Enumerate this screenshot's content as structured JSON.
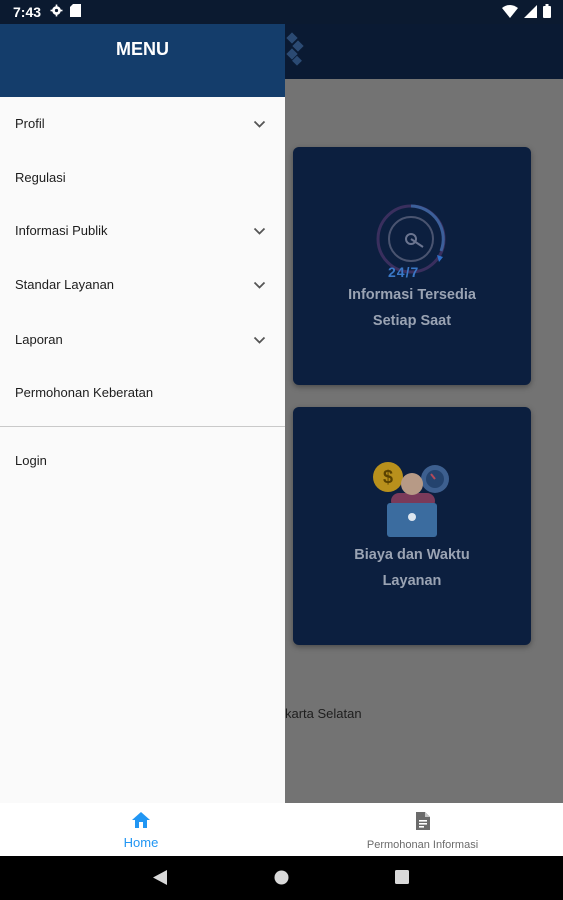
{
  "status_bar": {
    "time": "7:43",
    "icons": [
      "gear-icon",
      "sd-card-icon",
      "wifi-icon",
      "signal-icon",
      "battery-icon"
    ]
  },
  "drawer": {
    "title": "MENU",
    "items": [
      {
        "label": "Profil",
        "expandable": true
      },
      {
        "label": "Regulasi",
        "expandable": false
      },
      {
        "label": "Informasi Publik",
        "expandable": true
      },
      {
        "label": "Standar Layanan",
        "expandable": true
      },
      {
        "label": "Laporan",
        "expandable": true
      },
      {
        "label": "Permohonan Keberatan",
        "expandable": false
      }
    ],
    "login_label": "Login"
  },
  "cards": [
    {
      "line1": "Informasi Tersedia",
      "line2": "Setiap Saat",
      "badge": "24/7"
    },
    {
      "line1": "Biaya dan Waktu",
      "line2": "Layanan"
    }
  ],
  "footer_text": "karta Selatan",
  "bottom_nav": {
    "home_label": "Home",
    "request_label": "Permohonan Informasi",
    "active": "Home"
  },
  "colors": {
    "drawer_header": "#143d6b",
    "app_header": "#0a1a33",
    "card_bg": "#0c1f3f",
    "active_nav": "#2196f3"
  }
}
